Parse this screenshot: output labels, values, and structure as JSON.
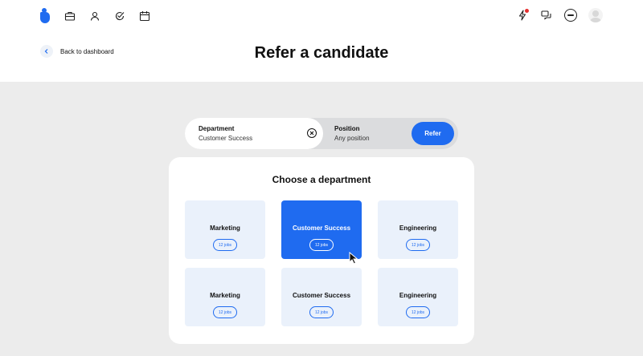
{
  "nav": {
    "left_icons": [
      "briefcase-icon",
      "person-icon",
      "check-badge-icon",
      "calendar-icon"
    ],
    "right_icons": [
      "bolt-icon",
      "chat-icon"
    ]
  },
  "header": {
    "back_label": "Back to dashboard",
    "title": "Refer a candidate"
  },
  "search": {
    "department": {
      "title": "Department",
      "value": "Customer Success"
    },
    "position": {
      "title": "Position",
      "value": "Any position"
    },
    "refer_label": "Refer"
  },
  "departments": {
    "title": "Choose a department",
    "tiles": [
      {
        "name": "Marketing",
        "jobs": "12 jobs",
        "selected": false
      },
      {
        "name": "Customer Success",
        "jobs": "12 jobs",
        "selected": true
      },
      {
        "name": "Engineering",
        "jobs": "12 jobs",
        "selected": false
      },
      {
        "name": "Marketing",
        "jobs": "12 jobs",
        "selected": false
      },
      {
        "name": "Customer Success",
        "jobs": "12 jobs",
        "selected": false
      },
      {
        "name": "Engineering",
        "jobs": "12 jobs",
        "selected": false
      }
    ]
  },
  "colors": {
    "accent": "#1f6bf0",
    "tile_bg": "#eaf1fb",
    "page_bg": "#ececec",
    "notification": "#e53030"
  }
}
